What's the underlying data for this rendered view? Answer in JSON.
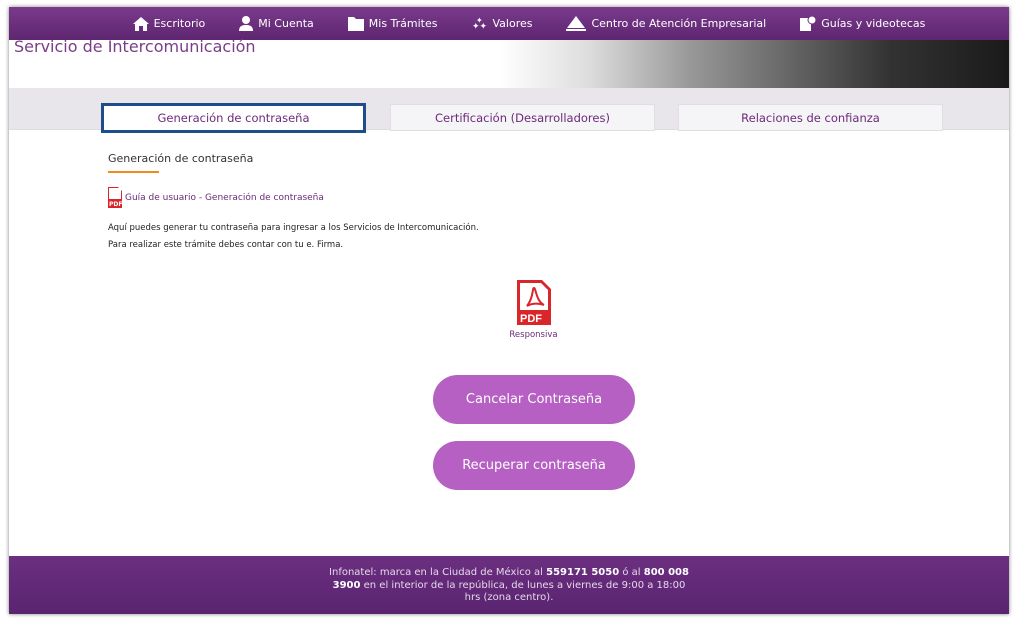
{
  "nav": [
    {
      "label": "Escritorio",
      "icon": "home-icon"
    },
    {
      "label": "Mi Cuenta",
      "icon": "user-icon"
    },
    {
      "label": "Mis Trámites",
      "icon": "folder-icon"
    },
    {
      "label": "Valores",
      "icon": "stars-icon"
    },
    {
      "label": "Centro de Atención Empresarial",
      "icon": "building-icon"
    },
    {
      "label": "Guías y videotecas",
      "icon": "guide-icon"
    }
  ],
  "banner": {
    "title": "Servicio de Intercomunicación"
  },
  "tabs": [
    {
      "label": "Generación de contraseña",
      "active": true
    },
    {
      "label": "Certificación (Desarrolladores)"
    },
    {
      "label": "Relaciones de confianza"
    }
  ],
  "section": {
    "title": "Generación de contraseña",
    "guide_link": "Guía de usuario - Generación de contraseña",
    "para1": "Aquí puedes generar tu contraseña para ingresar a los Servicios de Intercomunicación.",
    "para2": "Para realizar este trámite debes contar con tu e. Firma.",
    "pdf_label": "Responsiva",
    "cancel_button": "Cancelar Contraseña",
    "recover_button": "Recuperar contraseña"
  },
  "footer": {
    "t1": "Infonatel: marca en la Ciudad de México al ",
    "phone1": "559171 5050",
    "t2": " ó al ",
    "phone2": "800 008 3900",
    "t3": " en el interior de la república, de lunes a viernes de 9:00 a 18:00 hrs (zona centro)."
  },
  "colors": {
    "nav": "#6c2f80",
    "accent": "#b560c2",
    "underline": "#f08a1c",
    "tab_border": "#1e4d8c"
  }
}
